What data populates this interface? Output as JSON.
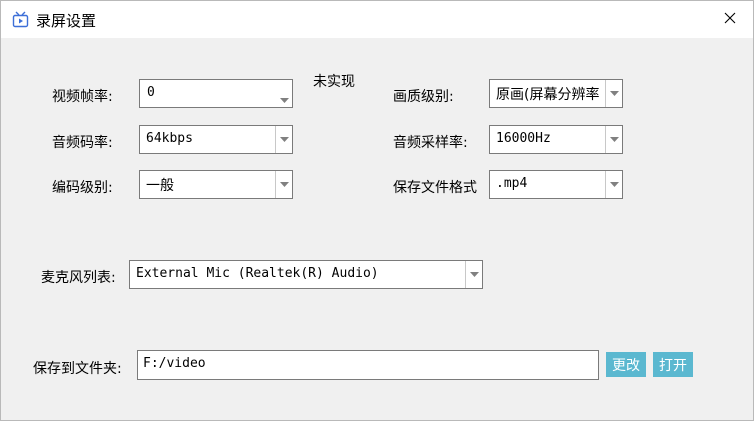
{
  "window": {
    "title": "录屏设置"
  },
  "fps": {
    "label": "视频帧率:",
    "value": "0",
    "note": "未实现"
  },
  "quality": {
    "label": "画质级别:",
    "value": "原画(屏幕分辨率"
  },
  "audio_bitrate": {
    "label": "音频码率:",
    "value": "64kbps"
  },
  "sample_rate": {
    "label": "音频采样率:",
    "value": "16000Hz"
  },
  "encode_level": {
    "label": "编码级别:",
    "value": "一般"
  },
  "file_format": {
    "label": "保存文件格式",
    "value": ".mp4"
  },
  "mic": {
    "label": "麦克风列表:",
    "value": "External Mic (Realtek(R) Audio)"
  },
  "save_folder": {
    "label": "保存到文件夹:",
    "value": "F:/video",
    "change_label": "更改",
    "open_label": "打开"
  },
  "colors": {
    "button_accent": "#5bb8d0",
    "title_icon": "#3d6fd8"
  },
  "icons": {
    "title": "tv-icon",
    "close": "close-icon",
    "dropdown": "chevron-down-icon"
  }
}
